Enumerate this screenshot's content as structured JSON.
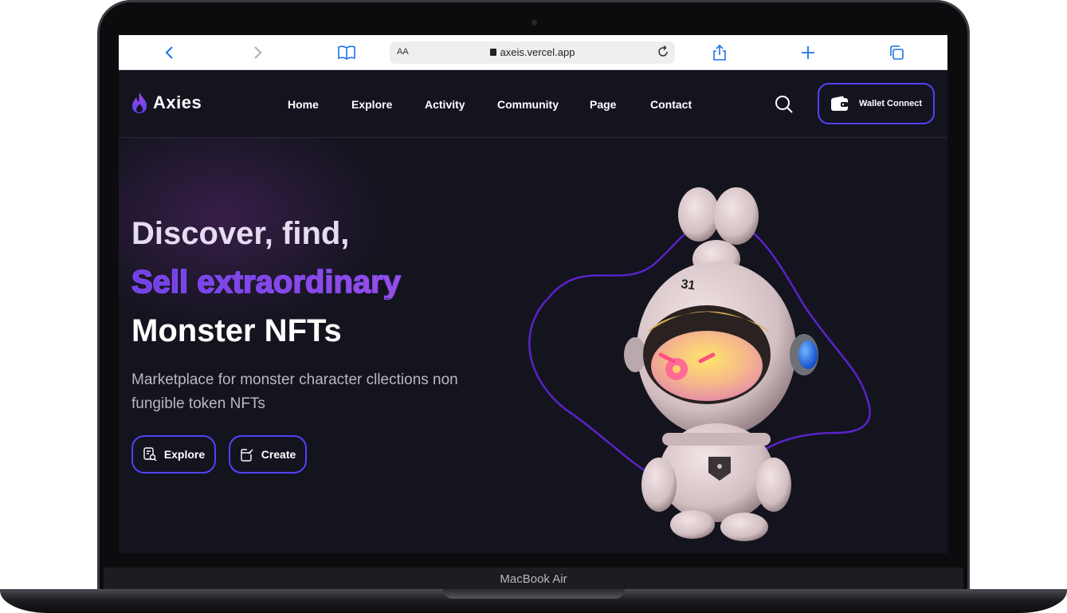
{
  "device": {
    "label": "MacBook Air"
  },
  "browser": {
    "aa_label": "AA",
    "url": "axeis.vercel.app",
    "icons": [
      "back-icon",
      "forward-icon",
      "bookmarks-icon",
      "lock-icon",
      "reload-icon",
      "share-icon",
      "new-tab-icon",
      "tabs-icon"
    ]
  },
  "site": {
    "logo_text": "Axies",
    "nav": [
      {
        "label": "Home"
      },
      {
        "label": "Explore"
      },
      {
        "label": "Activity"
      },
      {
        "label": "Community"
      },
      {
        "label": "Page"
      },
      {
        "label": "Contact"
      }
    ],
    "wallet_label": "Wallet Connect"
  },
  "hero": {
    "line1": "Discover, find,",
    "line2": "Sell extraordinary",
    "line3": "Monster NFTs",
    "description": "Marketplace for monster character cllections non fungible token NFTs",
    "explore_label": "Explore",
    "create_label": "Create"
  },
  "colors": {
    "accent": "#5142fc",
    "background": "#14141f",
    "gradient_text": "#7d4bf0"
  }
}
